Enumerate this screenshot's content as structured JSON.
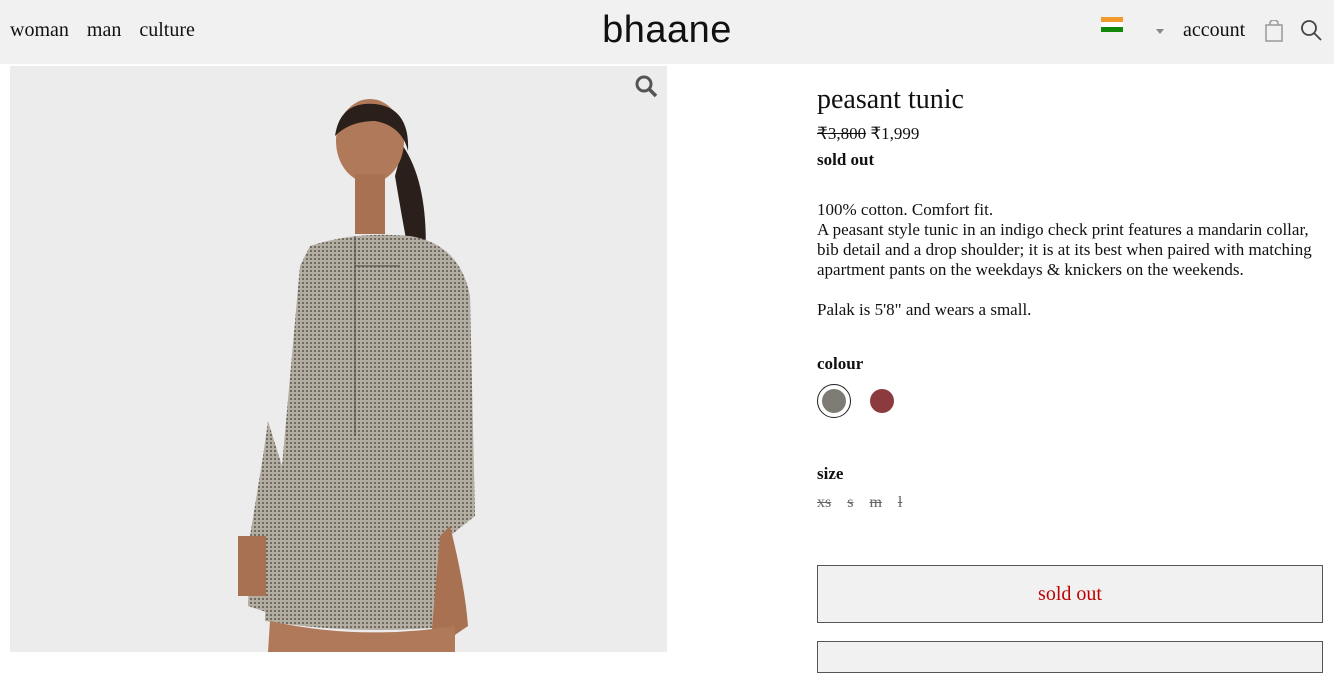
{
  "header": {
    "nav": [
      "woman",
      "man",
      "culture"
    ],
    "logo": "bhaane",
    "account_label": "account",
    "flag_colors": [
      "#f39a2c",
      "#ffffff",
      "#138808"
    ]
  },
  "product": {
    "title": "peasant tunic",
    "old_price": "₹3,800",
    "price": "₹1,999",
    "status": "sold out",
    "description_line1": "100% cotton. Comfort fit.",
    "description_line2": "A peasant style tunic in an indigo check print features a mandarin collar, bib detail and a drop shoulder; it is at its best when paired with matching apartment pants on the weekdays & knickers on the weekends.",
    "model_note": "Palak is 5'8\" and wears a small.",
    "colour_label": "colour",
    "colours": [
      "#7e7a74",
      "#8b3a3e"
    ],
    "size_label": "size",
    "sizes": [
      "xs",
      "s",
      "m",
      "l"
    ],
    "button_label": "sold out"
  }
}
